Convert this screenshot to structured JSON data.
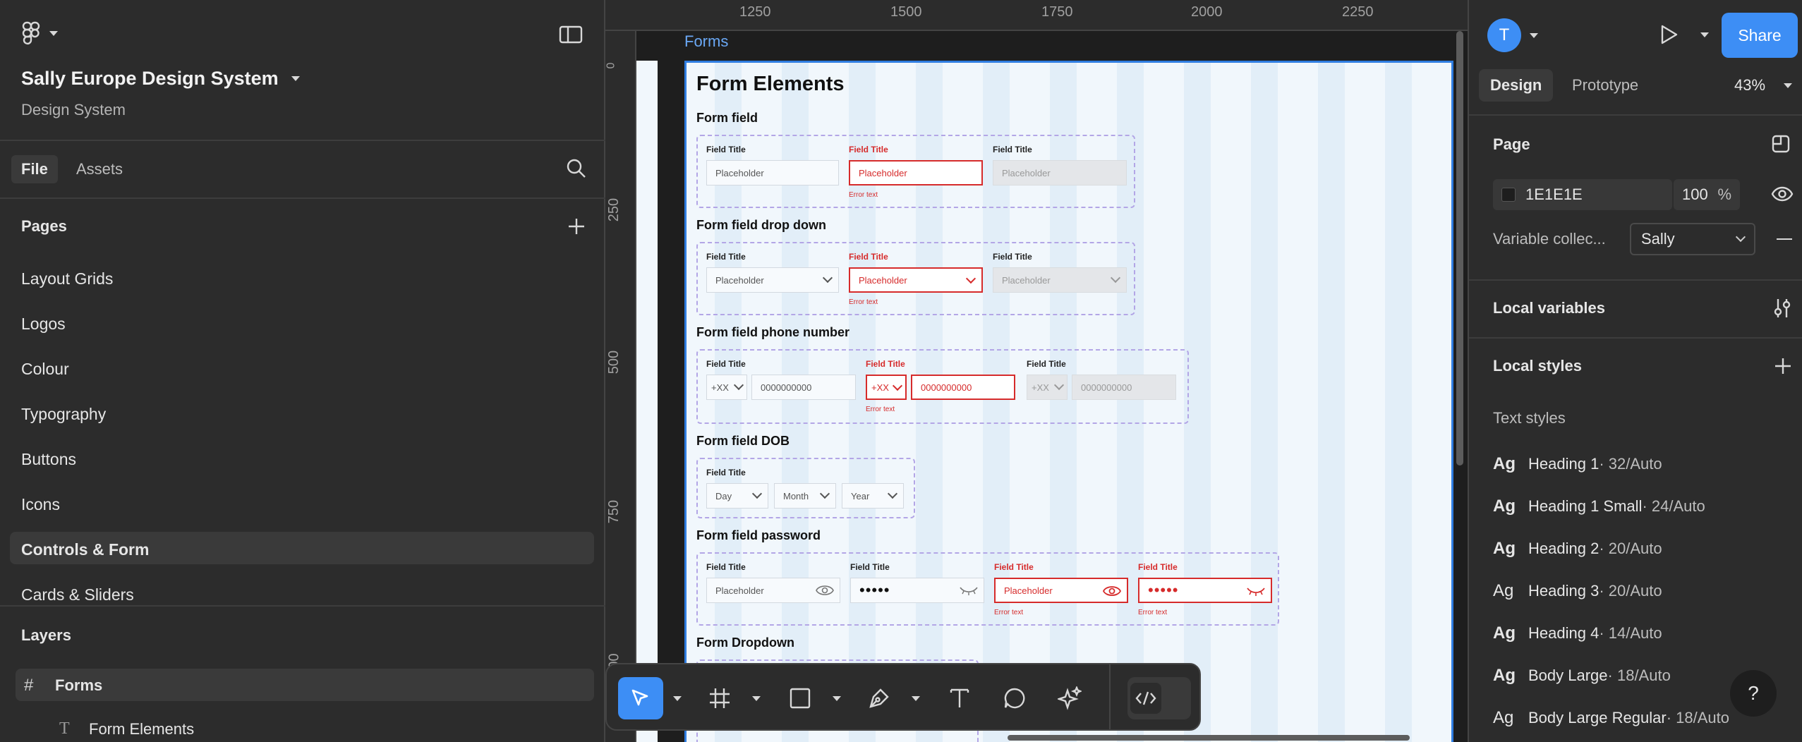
{
  "left_panel": {
    "file_name": "Sally Europe Design System",
    "subtitle": "Design System",
    "tabs": [
      "File",
      "Assets"
    ],
    "pages_heading": "Pages",
    "pages": [
      "Layout Grids",
      "Logos",
      "Colour",
      "Typography",
      "Buttons",
      "Icons",
      "Controls & Form",
      "Cards & Sliders"
    ],
    "selected_page": "Controls & Form",
    "layers_heading": "Layers",
    "layers": [
      {
        "name": "Forms",
        "icon": "frame-icon"
      },
      {
        "name": "Form Elements",
        "icon": "text-icon"
      }
    ]
  },
  "canvas": {
    "ruler_x": [
      "1250",
      "1500",
      "1750",
      "2000",
      "2250"
    ],
    "ruler_y": [
      "0",
      "250",
      "500",
      "750",
      "00"
    ],
    "frame_label": "Forms",
    "frame": {
      "title": "Form Elements",
      "sections": {
        "form_field": {
          "heading": "Form field",
          "fields": [
            {
              "label": "Field Title",
              "placeholder": "Placeholder",
              "state": "default"
            },
            {
              "label": "Field Title",
              "placeholder": "Placeholder",
              "state": "error",
              "error": "Error text"
            },
            {
              "label": "Field Title",
              "placeholder": "Placeholder",
              "state": "disabled"
            }
          ]
        },
        "drop_down": {
          "heading": "Form field drop down",
          "fields": [
            {
              "label": "Field Title",
              "placeholder": "Placeholder",
              "state": "default"
            },
            {
              "label": "Field Title",
              "placeholder": "Placeholder",
              "state": "error",
              "error": "Error text"
            },
            {
              "label": "Field Title",
              "placeholder": "Placeholder",
              "state": "disabled"
            }
          ]
        },
        "phone": {
          "heading": "Form field phone number",
          "fields": [
            {
              "label": "Field Title",
              "code": "+XX",
              "number": "0000000000",
              "state": "default"
            },
            {
              "label": "Field Title",
              "code": "+XX",
              "number": "0000000000",
              "state": "error",
              "error": "Error text"
            },
            {
              "label": "Field Title",
              "code": "+XX",
              "number": "0000000000",
              "state": "disabled"
            }
          ]
        },
        "dob": {
          "heading": "Form field DOB",
          "label": "Field Title",
          "parts": [
            "Day",
            "Month",
            "Year"
          ]
        },
        "password": {
          "heading": "Form field password",
          "fields": [
            {
              "label": "Field Title",
              "value": "Placeholder",
              "state": "default",
              "icon": "eye-icon"
            },
            {
              "label": "Field Title",
              "value": "•••••",
              "state": "filled",
              "icon": "eye-closed-icon"
            },
            {
              "label": "Field Title",
              "value": "Placeholder",
              "state": "error",
              "icon": "eye-icon",
              "error": "Error text"
            },
            {
              "label": "Field Title",
              "value": "•••••",
              "state": "error",
              "icon": "eye-closed-icon",
              "error": "Error text"
            }
          ]
        },
        "dropdown": {
          "heading": "Form Dropdown"
        }
      }
    }
  },
  "right_panel": {
    "avatar_initial": "T",
    "share_label": "Share",
    "tabs": [
      "Design",
      "Prototype"
    ],
    "zoom": "43%",
    "page_heading": "Page",
    "page_color": "1E1E1E",
    "page_opacity": "100",
    "page_opacity_unit": "%",
    "variable_label": "Variable collec...",
    "variable_value": "Sally",
    "local_variables": "Local variables",
    "local_styles": "Local styles",
    "text_styles_heading": "Text styles",
    "text_styles": [
      {
        "ag": "Ag",
        "name": "Heading 1",
        "size": " · 32/Auto"
      },
      {
        "ag": "Ag",
        "name": "Heading 1 Small",
        "size": " · 24/Auto"
      },
      {
        "ag": "Ag",
        "name": "Heading 2",
        "size": " · 20/Auto"
      },
      {
        "ag": "Ag",
        "name": "Heading 3",
        "size": " · 20/Auto"
      },
      {
        "ag": "Ag",
        "name": "Heading 4",
        "size": " · 14/Auto"
      },
      {
        "ag": "Ag",
        "name": "Body Large",
        "size": " · 18/Auto"
      },
      {
        "ag": "Ag",
        "name": "Body Large Regular",
        "size": " · 18/Auto"
      }
    ],
    "help_label": "?"
  },
  "colors": {
    "accent": "#3d8ef5",
    "error": "#d62b2b",
    "frame_border": "#2f7de1",
    "panel": "#2c2c2c",
    "canvas": "#1e1e1e"
  }
}
